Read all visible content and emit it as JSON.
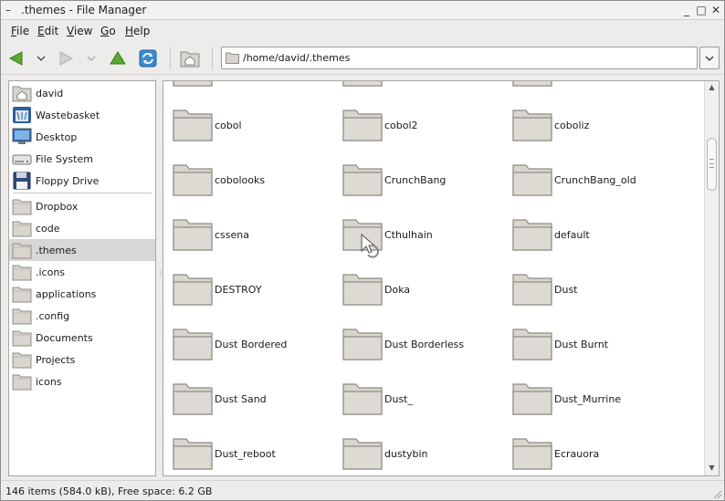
{
  "window": {
    "title": ".themes - File Manager",
    "minimize_glyph": "_",
    "maximize_glyph": "□",
    "close_glyph": "✕",
    "menu_glyph": "–"
  },
  "menubar": {
    "items": [
      {
        "label_u": "F",
        "label_rest": "ile"
      },
      {
        "label_u": "E",
        "label_rest": "dit"
      },
      {
        "label_u": "V",
        "label_rest": "iew"
      },
      {
        "label_u": "G",
        "label_rest": "o"
      },
      {
        "label_u": "H",
        "label_rest": "elp"
      }
    ]
  },
  "toolbar": {
    "location_path": "/home/david/.themes",
    "dropdown_glyph": "⌄"
  },
  "sidebar": {
    "places": [
      {
        "label": "david",
        "icon": "home-folder-icon"
      },
      {
        "label": "Wastebasket",
        "icon": "trash-icon"
      },
      {
        "label": "Desktop",
        "icon": "desktop-icon"
      },
      {
        "label": "File System",
        "icon": "drive-icon"
      },
      {
        "label": "Floppy Drive",
        "icon": "floppy-icon"
      }
    ],
    "bookmarks": [
      {
        "label": "Dropbox"
      },
      {
        "label": "code"
      },
      {
        "label": ".themes",
        "selected": true
      },
      {
        "label": ".icons"
      },
      {
        "label": "applications"
      },
      {
        "label": ".config"
      },
      {
        "label": "Documents"
      },
      {
        "label": "Projects"
      },
      {
        "label": "icons"
      }
    ]
  },
  "files": [
    {
      "name": ""
    },
    {
      "name": ""
    },
    {
      "name": ""
    },
    {
      "name": "cobol"
    },
    {
      "name": "cobol2"
    },
    {
      "name": "coboliz"
    },
    {
      "name": "cobolooks"
    },
    {
      "name": "CrunchBang"
    },
    {
      "name": "CrunchBang_old"
    },
    {
      "name": "cssena"
    },
    {
      "name": "Cthulhain"
    },
    {
      "name": "default"
    },
    {
      "name": "DESTROY"
    },
    {
      "name": "Doka"
    },
    {
      "name": "Dust"
    },
    {
      "name": "Dust Bordered"
    },
    {
      "name": "Dust Borderless"
    },
    {
      "name": "Dust Burnt"
    },
    {
      "name": "Dust Sand"
    },
    {
      "name": "Dust_"
    },
    {
      "name": "Dust_Murrine"
    },
    {
      "name": "Dust_reboot"
    },
    {
      "name": "dustybin"
    },
    {
      "name": "Ecrauora"
    }
  ],
  "statusbar": {
    "text": "146 items (584.0 kB), Free space: 6.2 GB"
  },
  "colors": {
    "folder_body": "#d7d5cd",
    "folder_outline": "#8e8c85",
    "back_arrow": "#5aa832",
    "up_arrow": "#5aa832",
    "refresh": "#2f7fc4"
  }
}
